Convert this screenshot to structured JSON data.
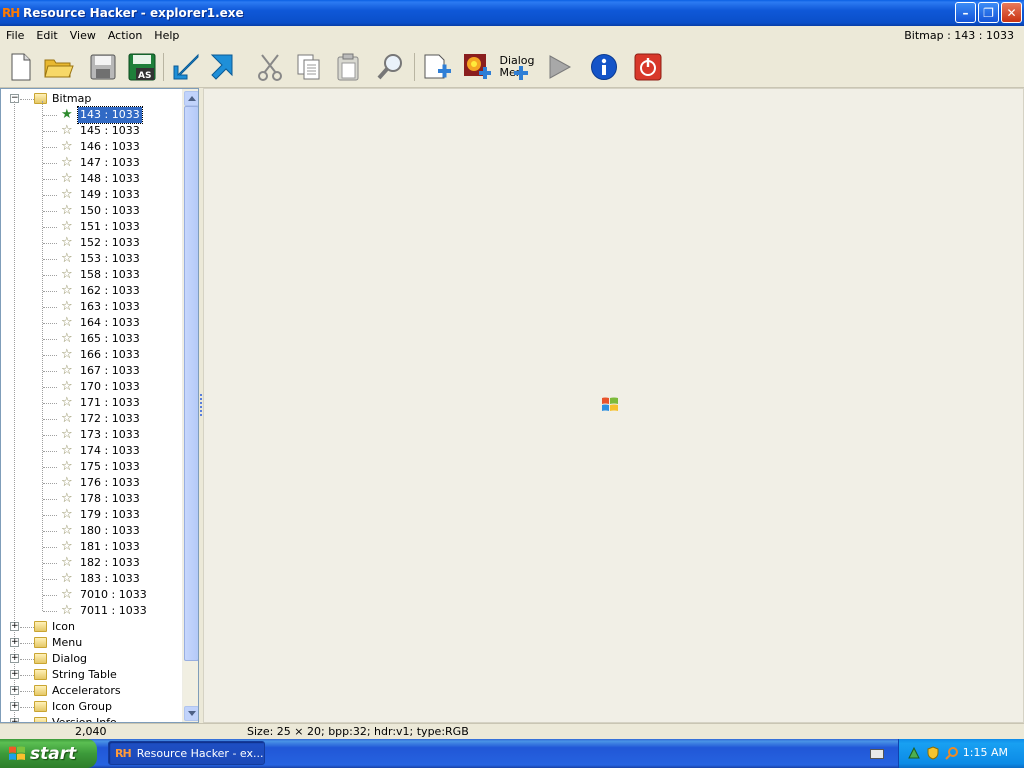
{
  "window": {
    "app_icon_text": "RH",
    "title": "Resource Hacker - explorer1.exe",
    "minimize_glyph": "–",
    "maximize_glyph": "❐",
    "close_glyph": "✕"
  },
  "menubar": {
    "items": [
      "File",
      "Edit",
      "View",
      "Action",
      "Help"
    ],
    "status": "Bitmap : 143 : 1033"
  },
  "toolbar": {
    "buttons": [
      {
        "icon": "new-file-icon"
      },
      {
        "icon": "open-folder-icon"
      },
      {
        "icon": "save-icon"
      },
      {
        "icon": "save-as-icon",
        "text": "AS"
      },
      {
        "icon": "import-arrow-icon"
      },
      {
        "icon": "export-arrow-icon"
      },
      {
        "icon": "cut-icon"
      },
      {
        "icon": "copy-icon"
      },
      {
        "icon": "paste-icon"
      },
      {
        "icon": "find-icon"
      },
      {
        "icon": "add-resource-icon"
      },
      {
        "icon": "add-image-icon"
      },
      {
        "icon": "dialog-menu-icon"
      },
      {
        "icon": "run-script-icon"
      },
      {
        "icon": "info-icon"
      },
      {
        "icon": "exit-icon"
      }
    ],
    "dialog_label_line1": "Dialog",
    "dialog_label_line2": "Mer"
  },
  "tree": {
    "root": "Bitmap",
    "bitmap_items": [
      "143 : 1033",
      "145 : 1033",
      "146 : 1033",
      "147 : 1033",
      "148 : 1033",
      "149 : 1033",
      "150 : 1033",
      "151 : 1033",
      "152 : 1033",
      "153 : 1033",
      "158 : 1033",
      "162 : 1033",
      "163 : 1033",
      "164 : 1033",
      "165 : 1033",
      "166 : 1033",
      "167 : 1033",
      "170 : 1033",
      "171 : 1033",
      "172 : 1033",
      "173 : 1033",
      "174 : 1033",
      "175 : 1033",
      "176 : 1033",
      "178 : 1033",
      "179 : 1033",
      "180 : 1033",
      "181 : 1033",
      "182 : 1033",
      "183 : 1033",
      "7010 : 1033",
      "7011 : 1033"
    ],
    "selected": "143 : 1033",
    "folders": [
      "Icon",
      "Menu",
      "Dialog",
      "String Table",
      "Accelerators",
      "Icon Group",
      "Version Info"
    ]
  },
  "statusbar": {
    "left": "2,040",
    "right": "Size: 25 × 20;  bpp:32;  hdr:v1;  type:RGB"
  },
  "taskbar": {
    "start_label": "start",
    "task_button_icon": "RH",
    "task_button_label": "Resource Hacker - ex...",
    "clock": "1:15 AM"
  },
  "colors": {
    "titlebar": "#0A4FC9",
    "selection": "#316AC5",
    "taskbar": "#2157D7",
    "start": "#3C9A3A",
    "tray": "#0C8BE6"
  }
}
